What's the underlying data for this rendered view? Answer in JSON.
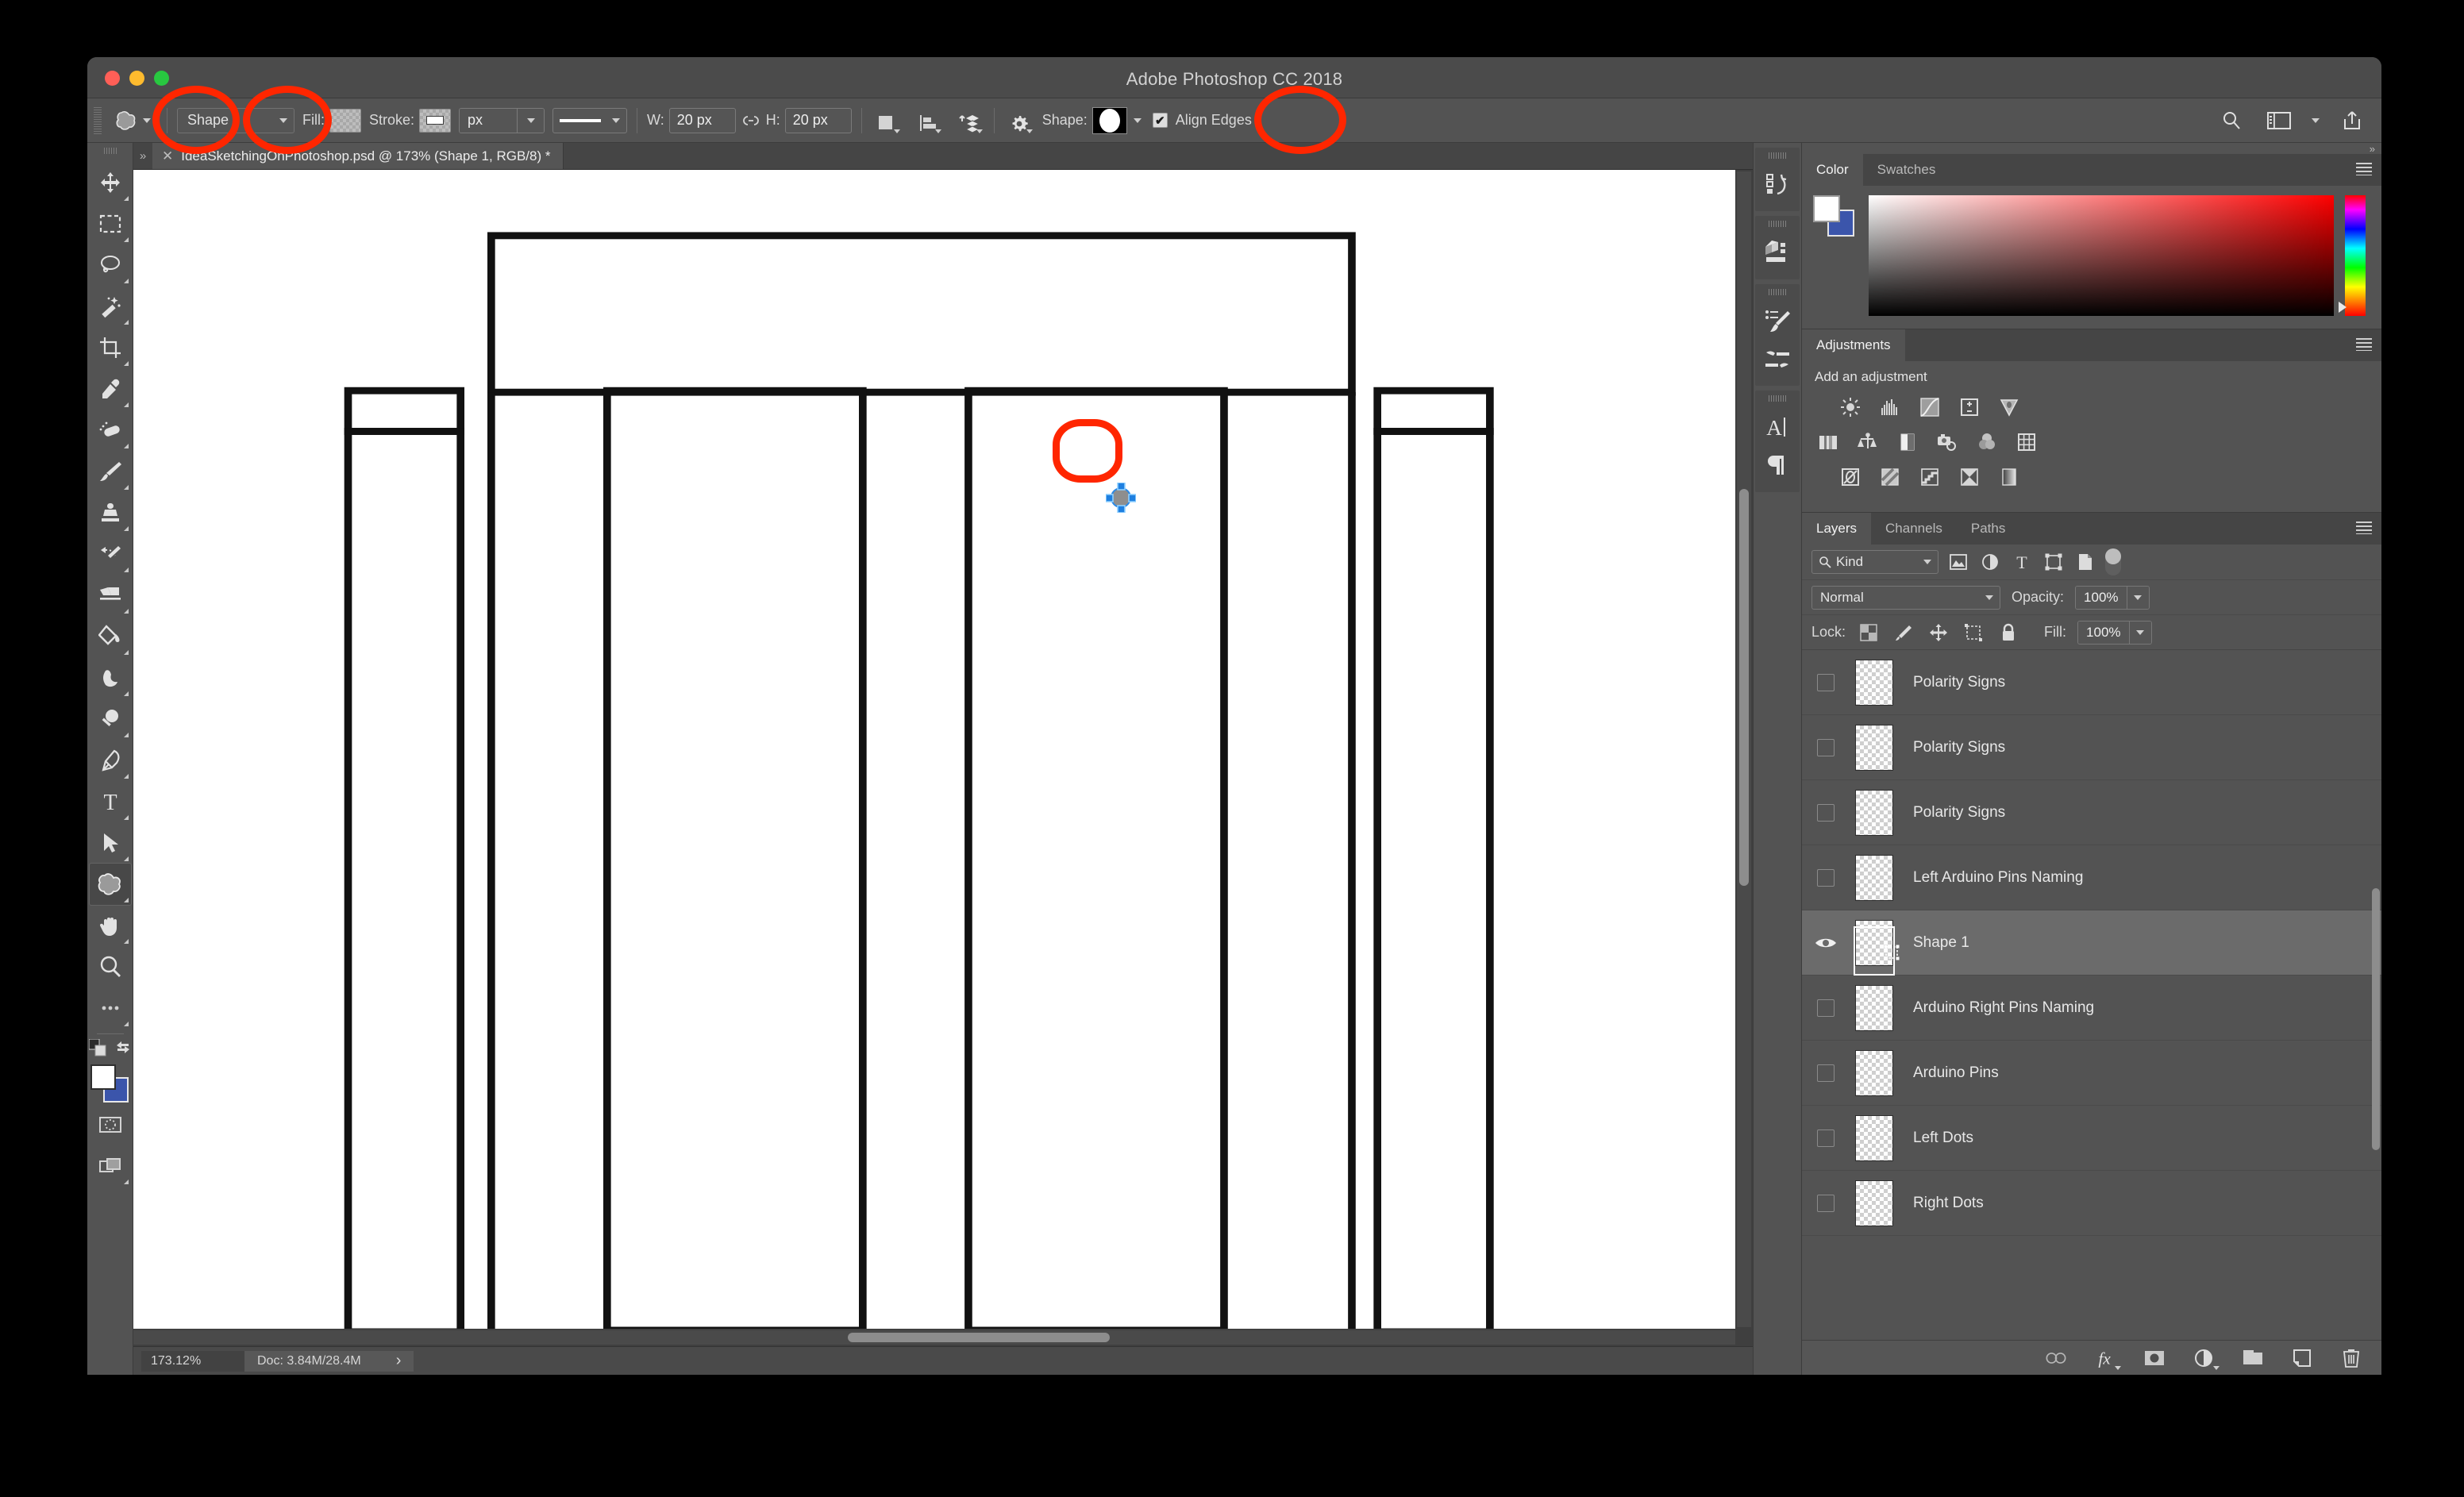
{
  "window": {
    "title": "Adobe Photoshop CC 2018",
    "traffic_lights": [
      "close",
      "minimize",
      "zoom"
    ]
  },
  "options_bar": {
    "tool_preset_icon": "custom-shape-icon",
    "mode_select": "Shape",
    "fill_label": "Fill:",
    "stroke_label": "Stroke:",
    "stroke_width": "px",
    "stroke_style_icon": "solid-line-icon",
    "width_label": "W:",
    "width_value": "20 px",
    "link_icon": "link-chain-icon",
    "height_label": "H:",
    "height_value": "20 px",
    "path_operations_icon": "path-operations-icon",
    "path_alignment_icon": "path-alignment-icon",
    "path_arrangement_icon": "path-arrangement-icon",
    "settings_icon": "gear-icon",
    "shape_label": "Shape:",
    "shape_preview": "white-ellipse-on-black",
    "align_edges_label": "Align Edges",
    "align_edges_checked": true,
    "search_icon": "search-icon",
    "workspace_icon": "workspace-switcher-icon",
    "share_icon": "share-icon"
  },
  "tools": [
    {
      "name": "move-tool",
      "icon": "move-icon",
      "active": false
    },
    {
      "name": "rectangular-marquee-tool",
      "icon": "marquee-icon",
      "active": false
    },
    {
      "name": "lasso-tool",
      "icon": "lasso-icon",
      "active": false
    },
    {
      "name": "magic-wand-tool",
      "icon": "magic-wand-icon",
      "active": false
    },
    {
      "name": "crop-tool",
      "icon": "crop-icon",
      "active": false
    },
    {
      "name": "eyedropper-tool",
      "icon": "eyedropper-icon",
      "active": false
    },
    {
      "name": "spot-healing-brush-tool",
      "icon": "healing-bandage-icon",
      "active": false
    },
    {
      "name": "brush-tool",
      "icon": "paintbrush-icon",
      "active": false
    },
    {
      "name": "clone-stamp-tool",
      "icon": "clone-stamp-icon",
      "active": false
    },
    {
      "name": "history-brush-tool",
      "icon": "history-brush-icon",
      "active": false
    },
    {
      "name": "eraser-tool",
      "icon": "eraser-icon",
      "active": false
    },
    {
      "name": "gradient-tool",
      "icon": "paint-bucket-icon",
      "active": false
    },
    {
      "name": "blur-tool",
      "icon": "smudge-finger-icon",
      "active": false
    },
    {
      "name": "dodge-tool",
      "icon": "dodge-icon",
      "active": false
    },
    {
      "name": "pen-tool",
      "icon": "pen-icon",
      "active": false
    },
    {
      "name": "type-tool",
      "icon": "type-t-icon",
      "active": false
    },
    {
      "name": "path-selection-tool",
      "icon": "path-arrow-icon",
      "active": false
    },
    {
      "name": "custom-shape-tool",
      "icon": "custom-shape-icon",
      "active": true
    },
    {
      "name": "hand-tool",
      "icon": "hand-icon",
      "active": false
    },
    {
      "name": "zoom-tool",
      "icon": "magnifier-icon",
      "active": false
    },
    {
      "name": "edit-toolbar",
      "icon": "ellipsis-icon",
      "active": false
    }
  ],
  "tool_extras": {
    "default_colors_icon": "default-colors-icon",
    "swap_colors_icon": "swap-colors-icon",
    "foreground_color": "#ffffff",
    "background_color": "#3b55ab",
    "quick_mask_icon": "quick-mask-icon",
    "screen_mode_icon": "screen-mode-icon"
  },
  "document": {
    "tab_close_icon": "close-icon",
    "tab_title": "IdeaSketchingOnPhotoshop.psd @ 173% (Shape 1, RGB/8) *"
  },
  "status_bar": {
    "zoom": "173.12%",
    "doc_info": "Doc: 3.84M/28.4M",
    "expand_icon": "chevron-right-icon"
  },
  "right_rail": [
    {
      "name": "history-panel-button",
      "icon": "history-icon"
    },
    {
      "name": "properties-panel-button",
      "icon": "properties-cube-icon"
    },
    {
      "name": "brush-presets-button",
      "icon": "brush-presets-icon"
    },
    {
      "name": "brush-settings-button",
      "icon": "brush-settings-icon"
    },
    {
      "name": "character-panel-button",
      "icon": "character-a-icon"
    },
    {
      "name": "paragraph-panel-button",
      "icon": "paragraph-pilcrow-icon"
    }
  ],
  "color_panel": {
    "tabs": [
      {
        "label": "Color",
        "active": true
      },
      {
        "label": "Swatches",
        "active": false
      }
    ],
    "menu_icon": "panel-menu-icon",
    "foreground": "#ffffff",
    "background": "#3b55ab"
  },
  "adjustments_panel": {
    "title": "Adjustments",
    "menu_icon": "panel-menu-icon",
    "prompt": "Add an adjustment",
    "rows": [
      [
        "brightness-contrast-icon",
        "levels-icon",
        "curves-icon",
        "exposure-icon",
        "vibrance-icon"
      ],
      [
        "hue-saturation-icon",
        "color-balance-icon",
        "black-white-icon",
        "photo-filter-icon",
        "channel-mixer-icon",
        "color-lookup-icon"
      ],
      [
        "invert-icon",
        "posterize-icon",
        "threshold-icon",
        "gradient-map-icon",
        "selective-color-icon"
      ]
    ]
  },
  "layers_panel": {
    "tabs": [
      {
        "label": "Layers",
        "active": true
      },
      {
        "label": "Channels",
        "active": false
      },
      {
        "label": "Paths",
        "active": false
      }
    ],
    "menu_icon": "panel-menu-icon",
    "filter_kind": "Kind",
    "filter_search_icon": "search-icon",
    "filter_icons": [
      "filter-pixel-icon",
      "filter-adjustment-icon",
      "filter-type-icon",
      "filter-shape-icon",
      "filter-smartobject-icon"
    ],
    "filter_toggle_icon": "filter-enable-toggle",
    "blend_mode": "Normal",
    "opacity_label": "Opacity:",
    "opacity_value": "100%",
    "lock_label": "Lock:",
    "lock_icons": [
      "lock-transparent-pixels-icon",
      "lock-image-pixels-icon",
      "lock-position-icon",
      "lock-artboard-icon",
      "lock-all-icon"
    ],
    "fill_label": "Fill:",
    "fill_value": "100%",
    "layers": [
      {
        "name": "Polarity Signs",
        "visible": false,
        "selected": false
      },
      {
        "name": "Polarity Signs",
        "visible": false,
        "selected": false
      },
      {
        "name": "Polarity Signs",
        "visible": false,
        "selected": false
      },
      {
        "name": "Left Arduino Pins Naming",
        "visible": false,
        "selected": false
      },
      {
        "name": "Shape 1",
        "visible": true,
        "selected": true
      },
      {
        "name": "Arduino Right Pins Naming",
        "visible": false,
        "selected": false
      },
      {
        "name": "Arduino Pins",
        "visible": false,
        "selected": false
      },
      {
        "name": "Left Dots",
        "visible": false,
        "selected": false
      },
      {
        "name": "Right Dots",
        "visible": false,
        "selected": false
      }
    ],
    "footer_icons": [
      "link-layers-icon",
      "layer-style-fx-icon",
      "add-layer-mask-icon",
      "new-adjustment-layer-icon",
      "new-group-icon",
      "new-layer-icon",
      "delete-layer-icon"
    ]
  },
  "annotations": {
    "color": "#ff2600",
    "circles": [
      {
        "name": "fill-swatch-highlight"
      },
      {
        "name": "stroke-swatch-highlight"
      },
      {
        "name": "shape-preset-highlight"
      },
      {
        "name": "canvas-shape-highlight"
      }
    ]
  },
  "canvas": {
    "description": "line-art sketch of a breadboard/arduino outline on white background",
    "shape_marker": "selected-ellipse-with-handles"
  }
}
